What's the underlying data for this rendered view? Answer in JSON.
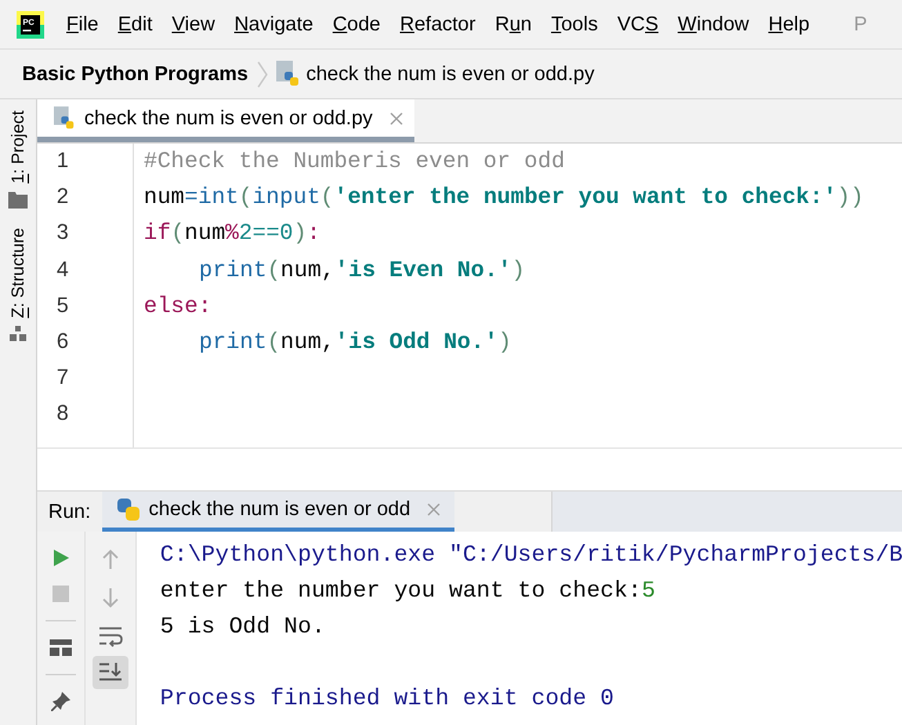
{
  "logo_text": "PC",
  "menu": [
    {
      "key": "F",
      "post": "ile"
    },
    {
      "key": "E",
      "post": "dit"
    },
    {
      "key": "V",
      "post": "iew"
    },
    {
      "key": "N",
      "post": "avigate"
    },
    {
      "key": "C",
      "post": "ode"
    },
    {
      "key": "R",
      "post": "efactor"
    },
    {
      "pre": "R",
      "key": "u",
      "post": "n"
    },
    {
      "key": "T",
      "post": "ools"
    },
    {
      "pre": "VC",
      "key": "S"
    },
    {
      "key": "W",
      "post": "indow"
    },
    {
      "key": "H",
      "post": "elp"
    }
  ],
  "menu_overflow": "P",
  "breadcrumb": {
    "project": "Basic Python Programs",
    "file": "check the num is even or odd.py"
  },
  "tool_windows": [
    {
      "key": "1",
      "post": ": Project"
    },
    {
      "key": "Z",
      "post": ": Structure"
    }
  ],
  "editor_tabs": [
    {
      "label": "check the num is even or odd.py",
      "selected": true
    }
  ],
  "code": [
    {
      "number": "1",
      "indent": false,
      "tokens": [
        {
          "text": "#Check the Numberis even or odd",
          "kind": "comment"
        }
      ]
    },
    {
      "number": "2",
      "indent": false,
      "tokens": [
        {
          "text": "num",
          "kind": "plain"
        },
        {
          "text": "=",
          "kind": "op"
        },
        {
          "text": "int",
          "kind": "builtin"
        },
        {
          "text": "(",
          "kind": "paren"
        },
        {
          "text": "input",
          "kind": "builtin"
        },
        {
          "text": "(",
          "kind": "paren"
        },
        {
          "text": "'enter the number you want to check:'",
          "kind": "string"
        },
        {
          "text": "))",
          "kind": "paren"
        }
      ]
    },
    {
      "number": "3",
      "indent": false,
      "tokens": [
        {
          "text": "if",
          "kind": "keyword"
        },
        {
          "text": "(",
          "kind": "paren"
        },
        {
          "text": "num",
          "kind": "plain"
        },
        {
          "text": "%",
          "kind": "keyword"
        },
        {
          "text": "2==0",
          "kind": "number"
        },
        {
          "text": ")",
          "kind": "paren"
        },
        {
          "text": ":",
          "kind": "keyword"
        }
      ]
    },
    {
      "number": "4",
      "indent": true,
      "tokens": [
        {
          "text": "print",
          "kind": "builtin"
        },
        {
          "text": "(",
          "kind": "paren"
        },
        {
          "text": "num",
          "kind": "plain"
        },
        {
          "text": ",",
          "kind": "plain"
        },
        {
          "text": "'is Even No.'",
          "kind": "string"
        },
        {
          "text": ")",
          "kind": "paren"
        }
      ]
    },
    {
      "number": "5",
      "indent": false,
      "tokens": [
        {
          "text": "else:",
          "kind": "keyword"
        }
      ]
    },
    {
      "number": "6",
      "indent": true,
      "tokens": [
        {
          "text": "print",
          "kind": "builtin"
        },
        {
          "text": "(",
          "kind": "paren"
        },
        {
          "text": "num",
          "kind": "plain"
        },
        {
          "text": ",",
          "kind": "plain"
        },
        {
          "text": "'is Odd No.'",
          "kind": "string"
        },
        {
          "text": ")",
          "kind": "paren"
        }
      ]
    },
    {
      "number": "7",
      "indent": false
    },
    {
      "number": "8",
      "indent": false
    }
  ],
  "run": {
    "label": "Run:",
    "tabs": [
      {
        "label": "check the num is even or odd",
        "selected": true
      }
    ],
    "scroll_to_end_on": true,
    "output": [
      {
        "tokens": [
          {
            "text": "C:\\Python\\python.exe \"C:/Users/ritik/PycharmProjects/B",
            "kind": "system"
          }
        ]
      },
      {
        "tokens": [
          {
            "text": "enter the number you want to check:",
            "kind": "plain"
          },
          {
            "text": "5",
            "kind": "input"
          }
        ]
      },
      {
        "tokens": [
          {
            "text": "5 is Odd No.",
            "kind": "plain"
          }
        ]
      }
    ],
    "exit_message": "Process finished with exit code 0"
  }
}
